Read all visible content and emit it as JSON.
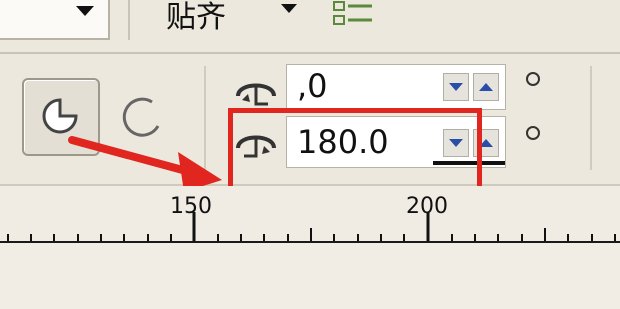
{
  "snap_toolbar": {
    "snap_label": "贴齐",
    "snap_icon": "snap-options-icon"
  },
  "ellipse_props": {
    "pie_icon": "pie-mode-icon",
    "arc_icon": "arc-mode-icon",
    "start_angle_icon": "start-angle-icon",
    "start_angle_value": ",0",
    "end_angle_icon": "end-angle-icon",
    "end_angle_value": "180.0",
    "direction_toggle_icon": "direction-radio-icon"
  },
  "annotation": {
    "arrow_color": "#e0261f",
    "highlight_color": "#e0261f"
  },
  "ruler": {
    "labels": [
      "150",
      "200"
    ]
  },
  "colors": {
    "toolbar_bg": "#ece8de",
    "spin_arrow": "#2a4ea8"
  }
}
